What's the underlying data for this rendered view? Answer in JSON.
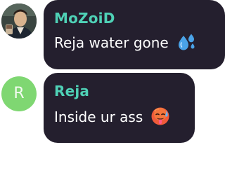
{
  "messages": [
    {
      "sender": "MoZoiD",
      "text": "Reja water gone",
      "emoji": "sweat-droplets-icon",
      "avatar": "profile-photo"
    },
    {
      "sender": "Reja",
      "text": "Inside ur ass",
      "emoji": "hot-face-icon",
      "avatar_letter": "R"
    }
  ],
  "colors": {
    "bubble_bg": "#241f2e",
    "sender_name": "#4fd1b6",
    "message_text": "#ffffff",
    "avatar_letter_bg": "#7fd772",
    "page_bg": "#ffffff"
  }
}
